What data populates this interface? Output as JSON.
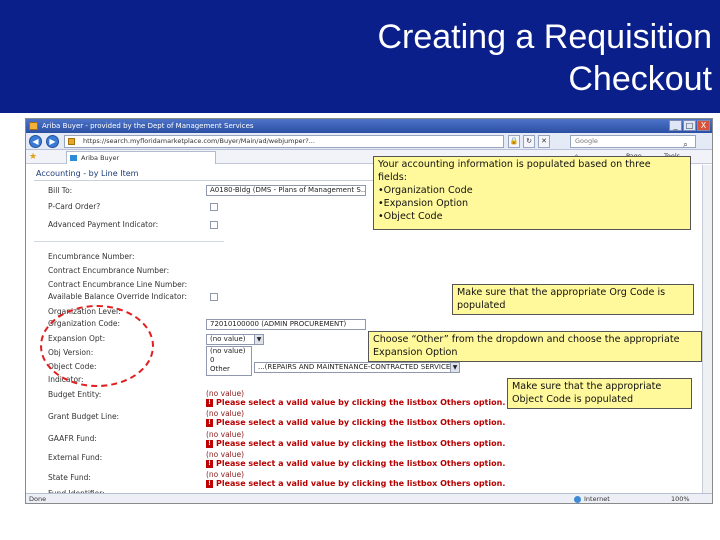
{
  "slide": {
    "title_line1": "Creating a Requisition",
    "title_line2": "Checkout"
  },
  "browser": {
    "window_title": "Ariba Buyer - provided by the Dept of Management Services",
    "window_buttons": [
      "_",
      "□",
      "X"
    ],
    "address": "https://search.myfloridamarketplace.com/Buyer/Main/ad/webjumper?...",
    "search_placeholder": "Google",
    "tab_label": "Ariba Buyer",
    "page_menu": "Page",
    "tools_menu": "Tools",
    "status_left": "Done",
    "status_zone": "Internet",
    "status_zoom": "100%"
  },
  "form": {
    "section_title": "Accounting - by Line Item",
    "bill_to_label": "Bill To:",
    "bill_to_value": "A0180-Bldg (DMS - Plans of Management S...",
    "pcard_label": "P-Card Order?",
    "advance_payment_label": "Advanced Payment Indicator:",
    "encumbrance_label": "Encumbrance Number:",
    "contract_encumbrance_label": "Contract Encumbrance Number:",
    "contract_encumbrance_line_label": "Contract Encumbrance Line Number:",
    "available_balance_label": "Available Balance Override Indicator:",
    "organization_level_label": "Organization Level:",
    "organization_code_label": "Organization Code:",
    "organization_code_value": "72010100000 (ADMIN PROCUREMENT)",
    "expansion_option_label": "Expansion Opt:",
    "expansion_option_value": "(no value)",
    "dropdown_options": [
      "(no value)",
      "0",
      "Other"
    ],
    "object_version_label": "Obj Version:",
    "object_code_label": "Object Code:",
    "object_code_value": "...(REPAIRS AND MAINTENANCE-CONTRACTED SERVICES)",
    "indicator_label": "Indicator:",
    "budget_entity_label": "Budget Entity:",
    "grant_budget_label": "Grant Budget Line:",
    "gaafr_fund_label": "GAAFR Fund:",
    "external_fund_label": "External Fund:",
    "state_fund_label": "State Fund:",
    "fund_identifier_label": "Fund Identifier:",
    "no_value": "(no value)",
    "error_text": "Please select a valid value by clicking the listbox Others option."
  },
  "callouts": {
    "accounting": {
      "line1": "Your accounting information is populated based on three",
      "line2": "fields:",
      "line3": "•Organization Code",
      "line4": "•Expansion Option",
      "line5": "•Object Code"
    },
    "org_code": {
      "line1": "Make sure that the appropriate Org Code is",
      "line2": "populated"
    },
    "other": {
      "line1": "Choose “Other” from the dropdown and choose the appropriate",
      "line2": "Expansion Option"
    },
    "object_code": {
      "line1": "Make sure that the appropriate",
      "line2": "Object Code is populated"
    }
  },
  "colors": {
    "banner": "#0b1f8a",
    "callout": "#fff99c",
    "error": "#b80000",
    "highlight_ellipse": "#e02020"
  },
  "icons": [
    "app-icon",
    "back-icon",
    "forward-icon",
    "lock-icon",
    "refresh-icon",
    "stop-icon",
    "search-icon",
    "star-icon",
    "tab-icon",
    "home-icon",
    "globe-icon",
    "error-icon",
    "checkbox"
  ]
}
